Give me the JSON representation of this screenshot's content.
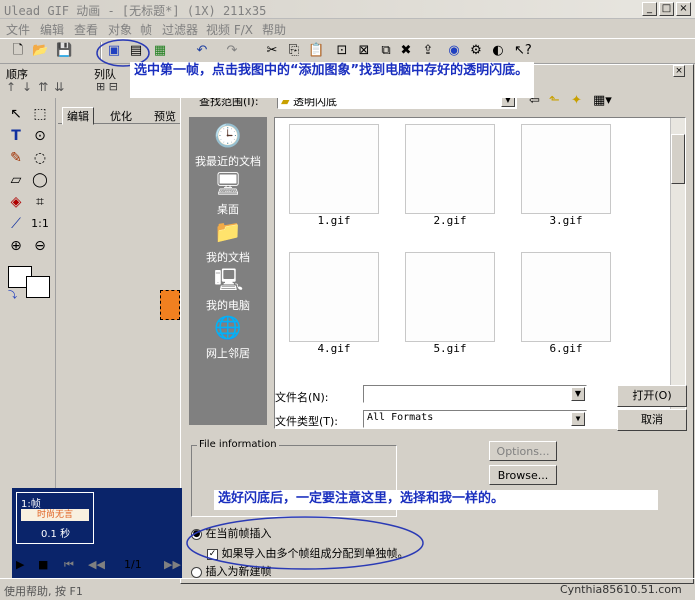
{
  "window": {
    "title": "Ulead GIF 动画 - [无标题*] (1X) 211x35",
    "controls": [
      "_",
      "□",
      "×"
    ]
  },
  "menu": [
    "文件",
    "编辑",
    "查看",
    "对象",
    "帧",
    "过滤器",
    "视频 F/X",
    "帮助"
  ],
  "left_panel": {
    "order_label": "顺序",
    "list_label": "列队",
    "tabs": [
      "编辑",
      "优化",
      "预览"
    ]
  },
  "annotations": {
    "top_note": "选中第一帧，点击我图中的“添加图象”找到电脑中存好的透明闪底。",
    "bottom_note": "选好闪底后，一定要注意这里，选择和我一样的。"
  },
  "dialog": {
    "lookin_label": "查找范围(I):",
    "lookin_value": "透明闪底",
    "places": [
      "我最近的文档",
      "桌面",
      "我的文档",
      "我的电脑",
      "网上邻居"
    ],
    "files": [
      "1.gif",
      "2.gif",
      "3.gif",
      "4.gif",
      "5.gif",
      "6.gif"
    ],
    "filename_label": "文件名(N):",
    "filename_value": "",
    "filetype_label": "文件类型(T):",
    "filetype_value": "All Formats",
    "open_button": "打开(O)",
    "cancel_button": "取消",
    "file_info_label": "File information",
    "options_button": "Options...",
    "browse_button": "Browse...",
    "radio_insert_current": "在当前帧插入",
    "checkbox_split": "如果导入由多个帧组成分配到单独帧。",
    "radio_insert_new": "插入为新建帧"
  },
  "frame_panel": {
    "frame_label": "1:帧",
    "frame_caption": "时尚无言",
    "delay": "0.1 秒",
    "page": "1/1"
  },
  "status": {
    "help": "使用帮助, 按 F1"
  },
  "watermark": "Cynthia85610.51.com",
  "colors": {
    "annotation": "#1a2fbf",
    "highlight_ellipse": "#2a3ab5",
    "frame_panel_bg": "#0a246a"
  }
}
